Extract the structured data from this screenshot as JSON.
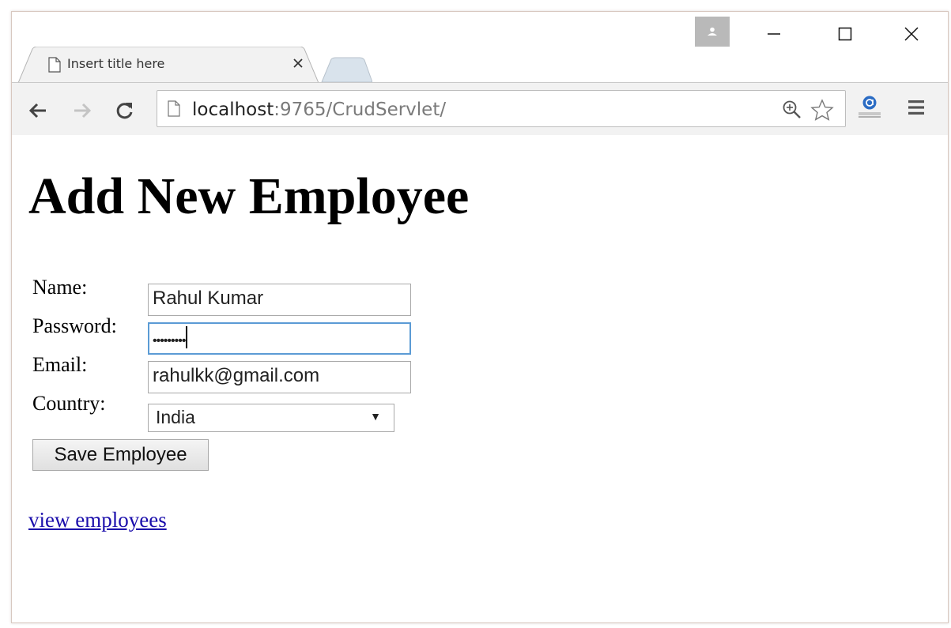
{
  "browser": {
    "tab_title": "Insert title here",
    "url_host": "localhost",
    "url_rest": ":9765/CrudServlet/",
    "icons": {
      "back": "back-arrow-icon",
      "forward": "forward-arrow-icon",
      "reload": "reload-icon",
      "page": "page-icon",
      "zoom": "zoom-in-icon",
      "star": "bookmark-star-icon",
      "extension": "extension-icon",
      "menu": "hamburger-menu-icon",
      "profile": "profile-icon",
      "minimize": "minimize-icon",
      "maximize": "maximize-icon",
      "close": "close-icon"
    }
  },
  "page": {
    "title": "Add New Employee",
    "form": {
      "name_label": "Name:",
      "name_value": "Rahul Kumar",
      "password_label": "Password:",
      "password_mask": "•••••••••",
      "email_label": "Email:",
      "email_value": "rahulkk@gmail.com",
      "country_label": "Country:",
      "country_value": "India",
      "save_label": "Save Employee"
    },
    "link_label": "view employees"
  },
  "colors": {
    "link": "#1a0dab",
    "focus_border": "#5b9bd5",
    "toolbar_bg": "#f2f2f2"
  }
}
